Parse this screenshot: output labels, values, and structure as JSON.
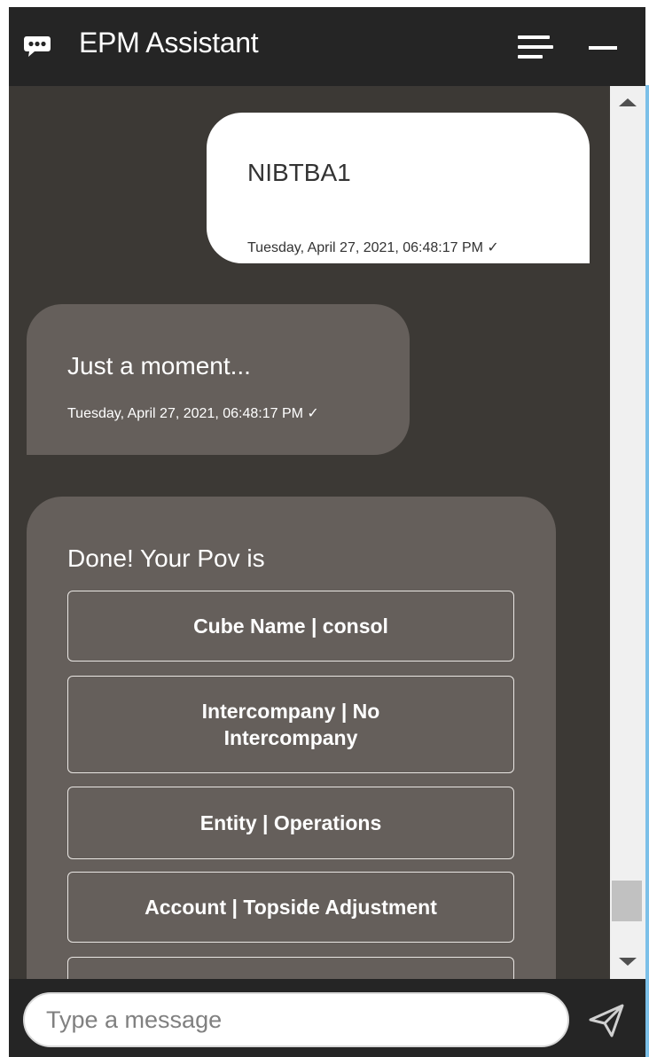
{
  "header": {
    "title": "EPM Assistant",
    "icons": {
      "app": "chat-bubble-icon",
      "menu": "hamburger-menu-icon",
      "minimize": "minimize-icon"
    }
  },
  "conversation": {
    "user_message": {
      "text": "NIBTBA1",
      "timestamp": "Tuesday, April 27, 2021, 06:48:17 PM"
    },
    "bot_message": {
      "text": "Just a moment...",
      "timestamp": "Tuesday, April 27, 2021, 06:48:17 PM"
    },
    "pov_message": {
      "text": "Done! Your Pov is",
      "options": [
        {
          "label": "Cube Name | consol"
        },
        {
          "label": "Intercompany | No Intercompany"
        },
        {
          "label": "Entity | Operations"
        },
        {
          "label": "Account | Topside Adjustment"
        },
        {
          "label": ""
        }
      ]
    }
  },
  "composer": {
    "placeholder": "Type a message",
    "send_icon": "send-icon"
  },
  "colors": {
    "header_bg": "#252525",
    "chat_bg": "#3c3935",
    "bot_bubble": "#655f5b",
    "user_bubble": "#ffffff",
    "accent_edge": "#7cc0e8"
  }
}
